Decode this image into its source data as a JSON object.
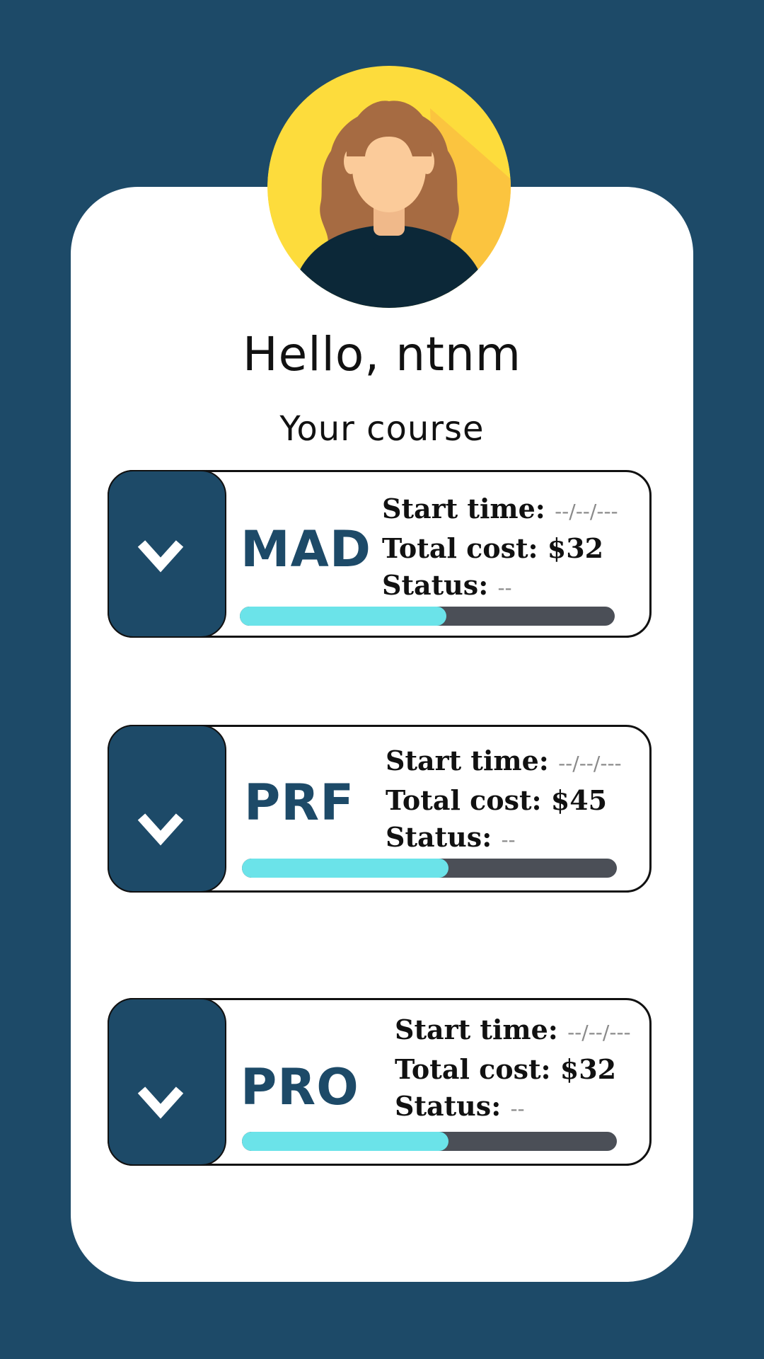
{
  "greeting": "Hello, ntnm",
  "section_title": "Your course",
  "colors": {
    "background": "#1d4a68",
    "accent": "#1d4a68",
    "progress_fill": "#6be3e9",
    "progress_track": "#4b4f57",
    "avatar_bg": "#fddc3c"
  },
  "icons": {
    "expand": "chevron-down-icon",
    "avatar": "woman-avatar"
  },
  "courses": [
    {
      "code": "MAD",
      "start_label": "Start time:",
      "start_value": "--/--/---",
      "cost_label": "Total cost:",
      "cost_value": "$32",
      "status_label": "Status:",
      "status_value": "--",
      "progress": 0.55
    },
    {
      "code": "PRF",
      "start_label": "Start time:",
      "start_value": "--/--/---",
      "cost_label": "Total cost:",
      "cost_value": "$45",
      "status_label": "Status:",
      "status_value": "--",
      "progress": 0.55
    },
    {
      "code": "PRO",
      "start_label": "Start time:",
      "start_value": "--/--/---",
      "cost_label": "Total cost:",
      "cost_value": "$32",
      "status_label": "Status:",
      "status_value": "--",
      "progress": 0.55
    }
  ]
}
